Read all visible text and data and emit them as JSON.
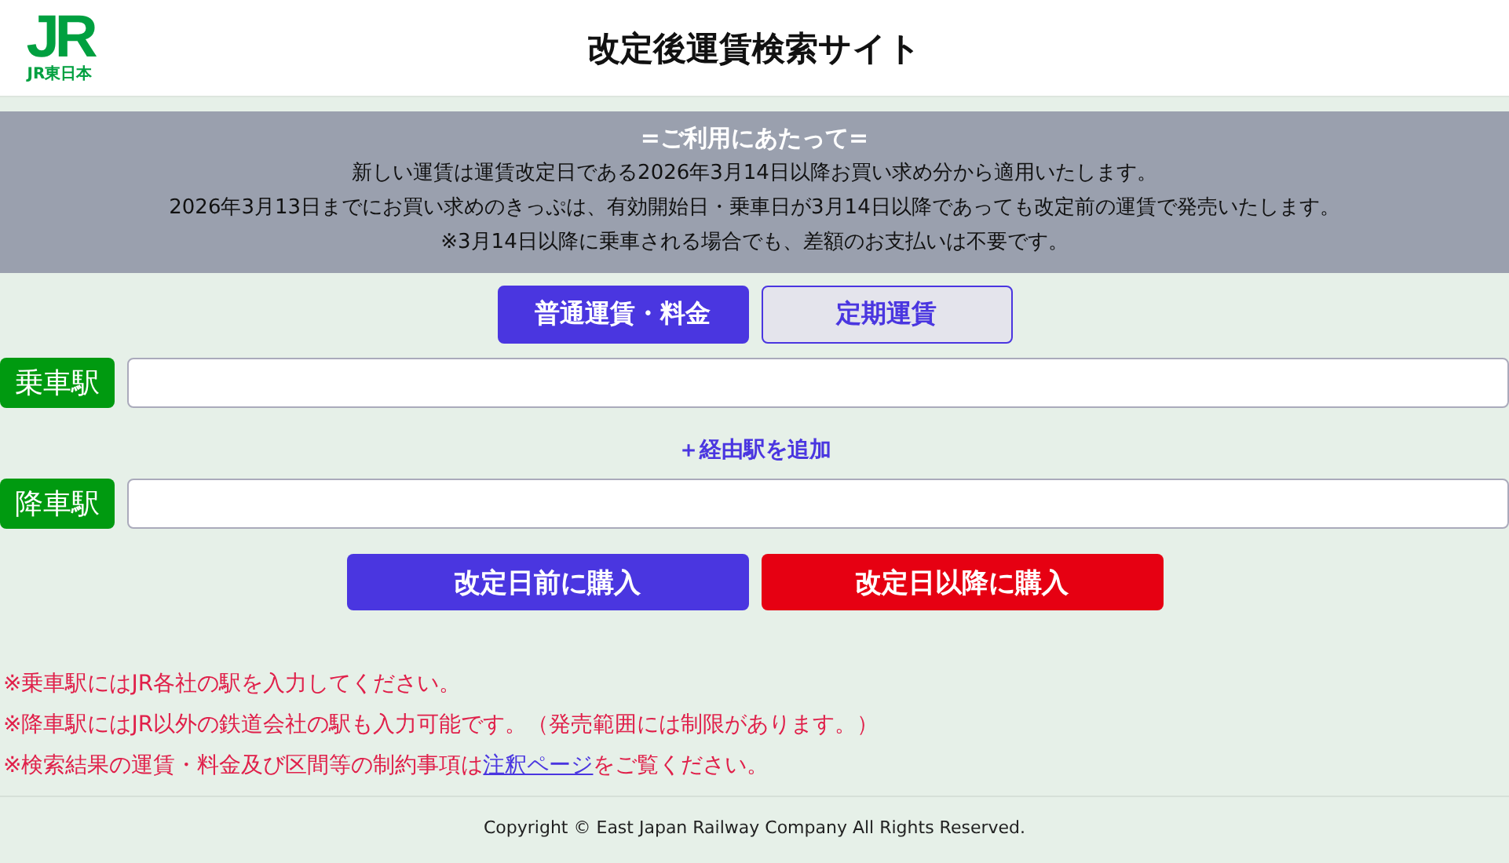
{
  "header": {
    "logo_mark": "JR",
    "logo_caption": "JR東日本",
    "title": "改定後運賃検索サイト"
  },
  "notice": {
    "heading": "=ご利用にあたって=",
    "lines": [
      "新しい運賃は運賃改定日である2026年3月14日以降お買い求め分から適用いたします。",
      "2026年3月13日までにお買い求めのきっぷは、有効開始日・乗車日が3月14日以降であっても改定前の運賃で発売いたします。",
      "※3月14日以降に乗車される場合でも、差額のお支払いは不要です。"
    ]
  },
  "tabs": [
    {
      "label": "普通運賃・料金",
      "selected": true
    },
    {
      "label": "定期運賃",
      "selected": false
    }
  ],
  "fields": [
    {
      "label": "乗車駅"
    },
    {
      "label": "降車駅"
    }
  ],
  "via_link": "＋経由駅を追加",
  "buttons": [
    {
      "label": "改定日前に購入",
      "kind": "before"
    },
    {
      "label": "改定日以降に購入",
      "kind": "after"
    }
  ],
  "notes": [
    {
      "text": "※乗車駅にはJR各社の駅を入力してください。"
    },
    {
      "text": "※降車駅にはJR以外の鉄道会社の駅も入力可能です。（発売範囲には制限があります。）"
    },
    {
      "text": "※検索結果の運賃・料金及び区間等の制約事項は",
      "link": "注釈ページ",
      "after": "をご覧ください。"
    }
  ],
  "footer": "Copyright © East Japan Railway Company All Rights Reserved."
}
